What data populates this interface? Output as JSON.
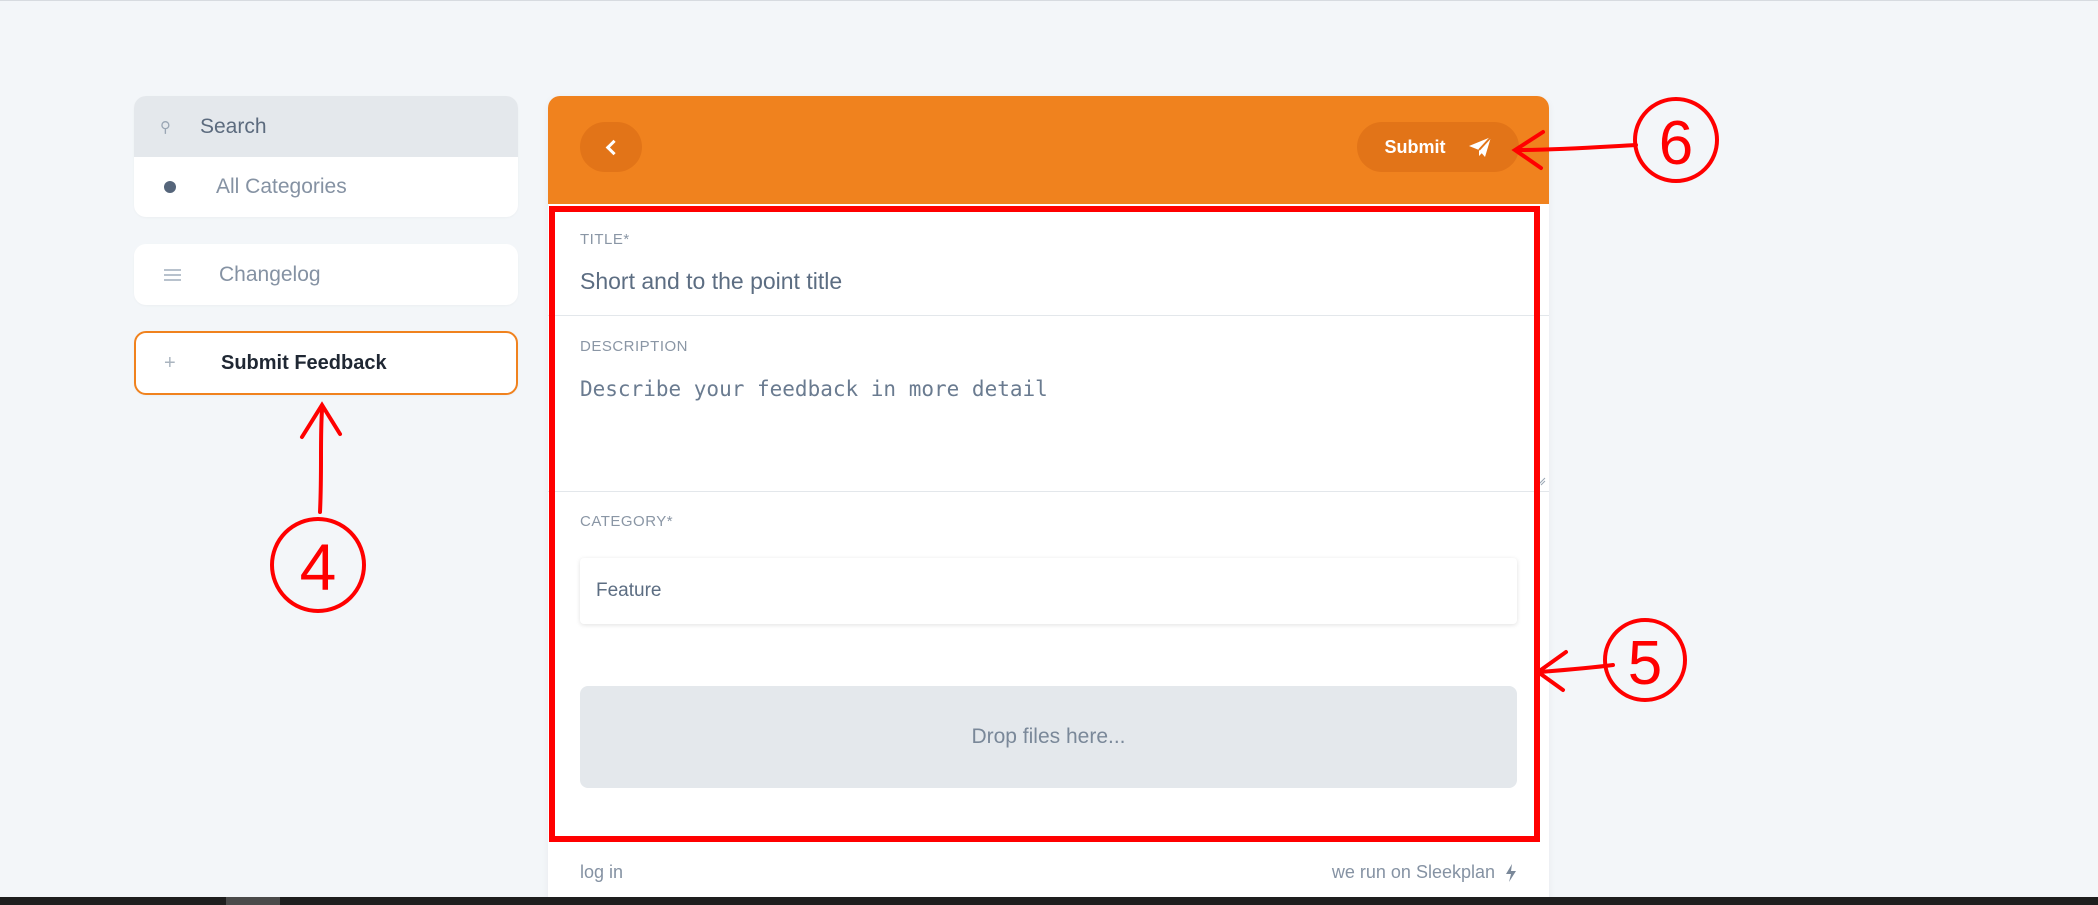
{
  "sidebar": {
    "search_label": "Search",
    "all_categories_label": "All Categories",
    "changelog_label": "Changelog",
    "submit_feedback_label": "Submit Feedback"
  },
  "header": {
    "submit_label": "Submit"
  },
  "form": {
    "title_label": "TITLE*",
    "title_placeholder": "Short and to the point title",
    "description_label": "DESCRIPTION",
    "description_placeholder": "Describe your feedback in more detail",
    "category_label": "CATEGORY*",
    "category_value": "Feature",
    "dropzone_label": "Drop files here..."
  },
  "footer": {
    "login_label": "log in",
    "powered_by_label": "we run on Sleekplan"
  },
  "annotations": {
    "marker_4": "4",
    "marker_5": "5",
    "marker_6": "6"
  },
  "colors": {
    "accent": "#f0821e",
    "annotation": "#ff0000"
  }
}
